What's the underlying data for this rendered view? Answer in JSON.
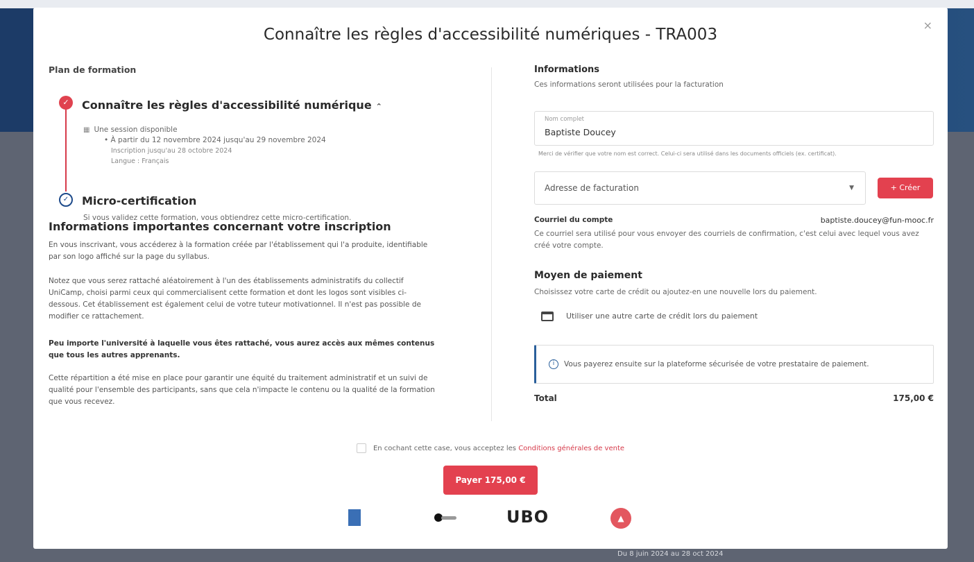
{
  "background": {
    "footer_text": "Du 8 juin 2024 au 28 oct 2024"
  },
  "modal": {
    "title": "Connaître les règles d'accessibilité numériques - TRA003",
    "close_label": "×"
  },
  "plan": {
    "label": "Plan de formation",
    "course_title": "Connaître les règles d'accessibilité numérique",
    "sessions_available": "Une session disponible",
    "session_dates": "• À partir du 12 novembre 2024 jusqu'au 29 novembre 2024",
    "registration_until": "Inscription jusqu'au 28 octobre 2024",
    "language": "Langue : Français",
    "micro_title": "Micro-certification",
    "micro_desc": "Si vous validez cette formation, vous obtiendrez cette micro-certification."
  },
  "important": {
    "title": "Informations importantes concernant votre inscription",
    "p1": "En vous inscrivant, vous accéderez à la formation créée par l'établissement qui l'a produite, identifiable par son logo affiché sur la page du syllabus.",
    "p2": "Notez que vous serez rattaché aléatoirement à l'un des établissements administratifs du collectif UniCamp, choisi parmi ceux qui commercialisent cette formation et dont les logos sont visibles ci-dessous. Cet établissement est également celui de votre tuteur motivationnel. Il n'est pas possible de modifier ce rattachement.",
    "p3": "Peu importe l'université à laquelle vous êtes rattaché, vous aurez accès aux mêmes contenus que tous les autres apprenants.",
    "p4": "Cette répartition a été mise en place pour garantir une équité du traitement administratif et un suivi de qualité pour l'ensemble des participants, sans que cela n'impacte le contenu ou la qualité de la formation que vous recevez."
  },
  "info": {
    "title": "Informations",
    "subtitle": "Ces informations seront utilisées pour la facturation",
    "name_label": "Nom complet",
    "name_value": "Baptiste Doucey",
    "name_hint": "Merci de vérifier que votre nom est correct. Celui-ci sera utilisé dans les documents officiels (ex. certificat).",
    "address_placeholder": "Adresse de facturation",
    "create_label": "+ Créer",
    "email_label": "Courriel du compte",
    "email_value": "baptiste.doucey@fun-mooc.fr",
    "email_desc": "Ce courriel sera utilisé pour vous envoyer des courriels de confirmation, c'est celui avec lequel vous avez créé votre compte."
  },
  "payment": {
    "title": "Moyen de paiement",
    "subtitle": "Choisissez votre carte de crédit ou ajoutez-en une nouvelle lors du paiement.",
    "card_option": "Utiliser une autre carte de crédit lors du paiement",
    "notice": "Vous payerez ensuite sur la plateforme sécurisée de votre prestataire de paiement.",
    "total_label": "Total",
    "total_amount": "175,00 €"
  },
  "footer": {
    "cgv_text": "En cochant cette case, vous acceptez les",
    "cgv_link": "Conditions générales de vente",
    "pay_label": "Payer 175,00 €",
    "logo3_text": "UBO"
  }
}
